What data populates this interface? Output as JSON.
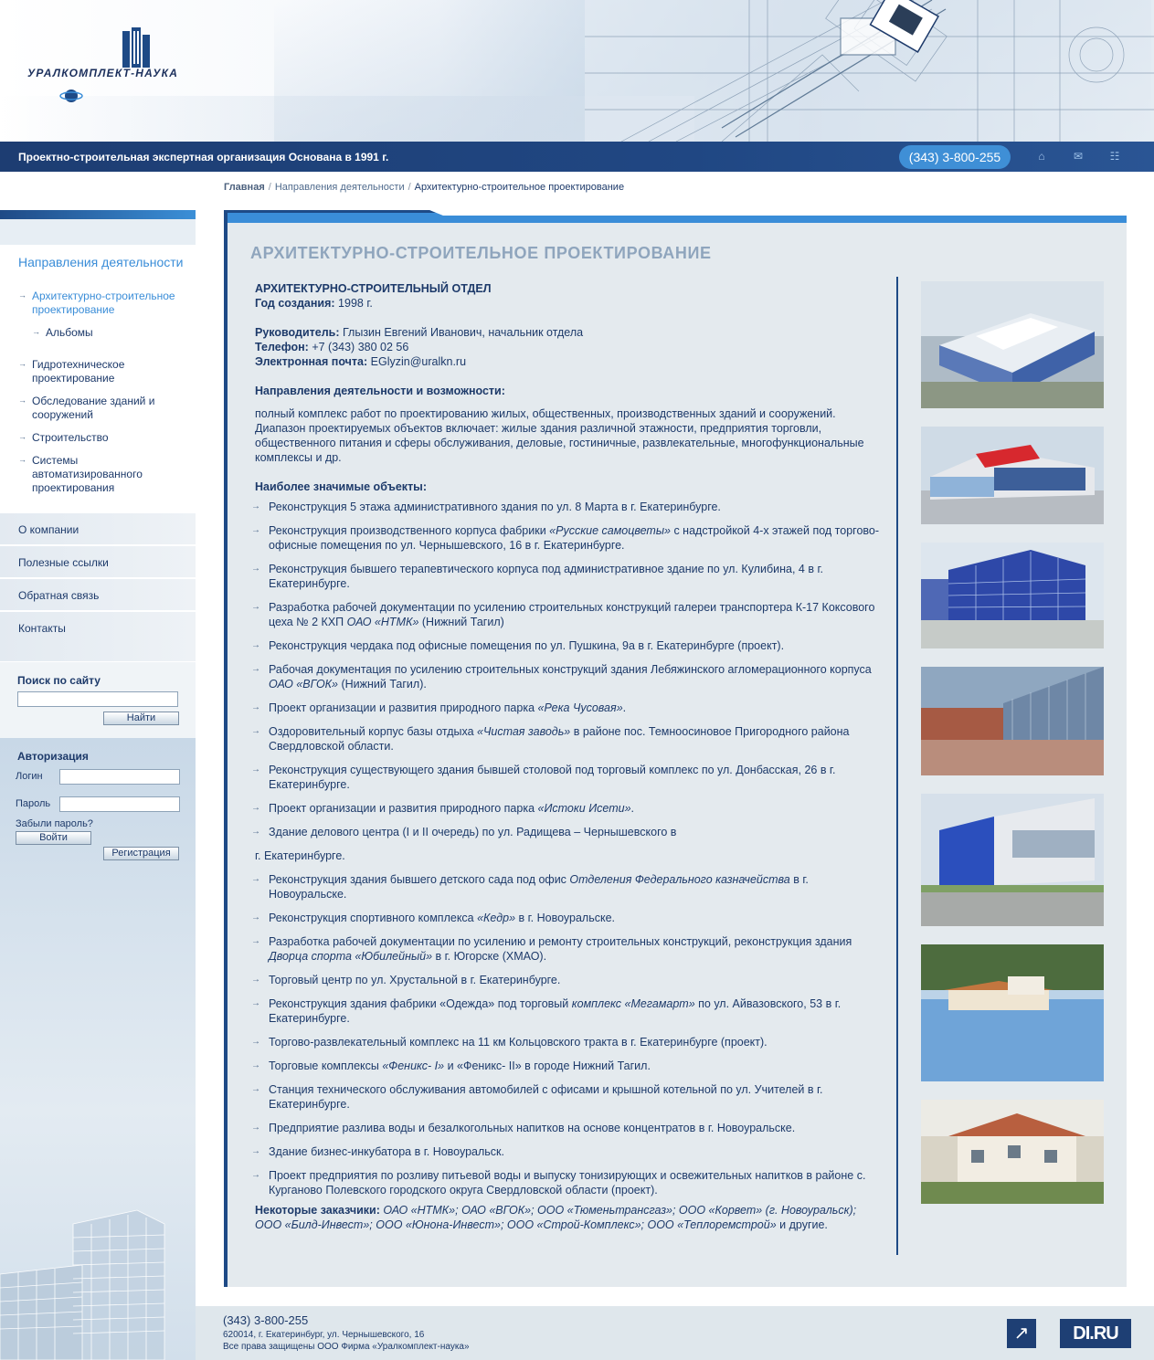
{
  "header": {
    "logo_text": "УРАЛКОМПЛЕКТ-НАУКА",
    "slogan": "Проектно-строительная экспертная организация Основана в 1991 г.",
    "phone": "(343) 3-800-255",
    "icons": [
      "home-icon",
      "mail-icon",
      "sitemap-icon"
    ]
  },
  "breadcrumb": {
    "home": "Главная",
    "section": "Направления деятельности",
    "current": "Архитектурно-строительное проектирование",
    "separator": "/"
  },
  "sidebar": {
    "title": "Направления деятельности",
    "items": [
      {
        "label": "Архитектурно-строительное проектирование",
        "active": true
      },
      {
        "label": "Альбомы",
        "sub": true
      },
      {
        "label": "Гидротехническое проектирование"
      },
      {
        "label": "Обследование зданий и сооружений"
      },
      {
        "label": "Строительство"
      },
      {
        "label": "Системы автоматизированного проектирования"
      }
    ],
    "bands": [
      "О компании",
      "Полезные ссылки",
      "Обратная связь",
      "Контакты"
    ],
    "search": {
      "title": "Поиск по сайту",
      "value": "",
      "button": "Найти"
    },
    "auth": {
      "title": "Авторизация",
      "login_label": "Логин",
      "password_label": "Пароль",
      "forgot": "Забыли пароль?",
      "login_button": "Войти",
      "register_button": "Регистрация"
    }
  },
  "main": {
    "title": "АРХИТЕКТУРНО-СТРОИТЕЛЬНОЕ ПРОЕКТИРОВАНИЕ",
    "dept": "АРХИТЕКТУРНО-СТРОИТЕЛЬНЫЙ ОТДЕЛ",
    "year_label": "Год создания:",
    "year_value": "1998 г.",
    "head_label": "Руководитель:",
    "head_value": "Глызин Евгений Иванович, начальник отдела",
    "phone_label": "Телефон:",
    "phone_value": "+7 (343) 380 02 56",
    "email_label": "Электронная почта:",
    "email_value": "EGlyzin@uralkn.ru",
    "directions_title": "Направления деятельности и возможности:",
    "directions_text": "полный комплекс работ по проектированию жилых, общественных, производственных зданий и сооружений. Диапазон проектируемых объектов включает: жилые здания различной этажности, предприятия торговли, общественного питания и сферы обслуживания, деловые, гостиничные, развлекательные, многофункциональные комплексы и др.",
    "objects_title": "Наиболее значимые объекты:",
    "objects": [
      [
        "Реконструкция 5 этажа административного здания по ул. 8 Марта в г. Екатеринбурге.",
        "",
        ""
      ],
      [
        "Реконструкция производственного корпуса фабрики ",
        "«Русские самоцветы»",
        " с  надстройкой 4-х этажей под торгово-офисные помещения по ул. Чернышевского, 16 в г. Екатеринбурге."
      ],
      [
        "Реконструкция бывшего терапевтического корпуса под административное здание по ул. Кулибина, 4  в г. Екатеринбурге.",
        "",
        ""
      ],
      [
        "Разработка рабочей документации по усилению строительных конструкций галереи транспортера К-17 Коксового цеха № 2 КХП  ",
        "ОАО «НТМК»",
        " (Нижний Тагил)"
      ],
      [
        "Реконструкция чердака под офисные помещения по ул. Пушкина, 9а в г.   Екатеринбурге (проект).",
        "",
        ""
      ],
      [
        "Рабочая документация по усилению строительных конструкций здания Лебяжинского агломерационного корпуса ",
        "ОАО «ВГОК»",
        " (Нижний Тагил)."
      ],
      [
        "Проект организации и развития природного парка ",
        "«Река Чусовая»",
        "."
      ],
      [
        "Оздоровительный корпус базы отдыха ",
        "«Чистая заводь»",
        " в районе пос. Темноосиновое Пригородного района Свердловской области."
      ],
      [
        "Реконструкция существующего здания бывшей столовой под торговый комплекс по ул. Донбасская, 26 в г. Екатеринбурге.",
        "",
        ""
      ],
      [
        "Проект организации и развития природного парка ",
        "«Истоки Исети»",
        "."
      ],
      [
        "Здание делового центра (I и II очередь) по ул. Радищева – Чернышевского в",
        "",
        ""
      ],
      [
        "г. Екатеринбурге.",
        "",
        "",
        "plain"
      ],
      [
        "Реконструкция здания бывшего детского сада под офис ",
        "Отделения Федерального  казначейства",
        " в г. Новоуральске."
      ],
      [
        "Реконструкция спортивного комплекса ",
        "«Кедр»",
        " в г. Новоуральске."
      ],
      [
        "Разработка рабочей документации по усилению и ремонту строительных конструкций, реконструкция здания ",
        "Дворца спорта «Юбилейный»",
        " в г. Югорске (ХМАО)."
      ],
      [
        "Торговый центр по ул. Хрустальной в г. Екатеринбурге.",
        "",
        ""
      ],
      [
        "Реконструкция здания фабрики «Одежда» под торговый ",
        "комплекс «Мегамарт»",
        " по ул. Айвазовского, 53 в г. Екатеринбурге."
      ],
      [
        "Торгово-развлекательный комплекс на 11 км Кольцовского тракта в г. Екатеринбурге (проект).",
        "",
        ""
      ],
      [
        "Торговые комплексы ",
        "«Феникс- I»",
        " и «Феникс- II» в городе Нижний Тагил."
      ],
      [
        "Станция технического обслуживания автомобилей с офисами и крышной котельной по ул. Учителей в г. Екатеринбурге.",
        "",
        ""
      ],
      [
        "Предприятие разлива воды и безалкогольных напитков на основе концентратов в г. Новоуральске.",
        "",
        ""
      ],
      [
        "Здание бизнес-инкубатора в г. Новоуральск.",
        "",
        ""
      ],
      [
        "Проект предприятия по розливу питьевой воды и выпуску тонизирующих и освежительных напитков в районе с. Курганово Полевского городского округа Свердловской области (проект).",
        "",
        ""
      ]
    ],
    "clients_label": "Некоторые заказчики:",
    "clients_italic": "ОАО «НТМК»; ОАО «ВГОК»; ООО «Тюменьтрансгаз»; ООО «Корвет» (г. Новоуральск); ООО «Билд-Инвест»; ООО «Юнона-Инвест»; ООО «Строй-Комплекс»; ООО «Теплоремстрой»",
    "clients_tail": " и другие."
  },
  "footer": {
    "phone": "(343) 3-800-255",
    "address": "620014, г. Екатеринбург, ул. Чернышевского, 16",
    "copyright": "Все права защищены ООО Фирма «Уралкомплект-наука»",
    "badge": "DI.RU"
  },
  "colors": {
    "navy": "#1e4a86",
    "accent": "#3a8dd8",
    "text": "#1d3a6a",
    "panel": "#e4eaee"
  }
}
